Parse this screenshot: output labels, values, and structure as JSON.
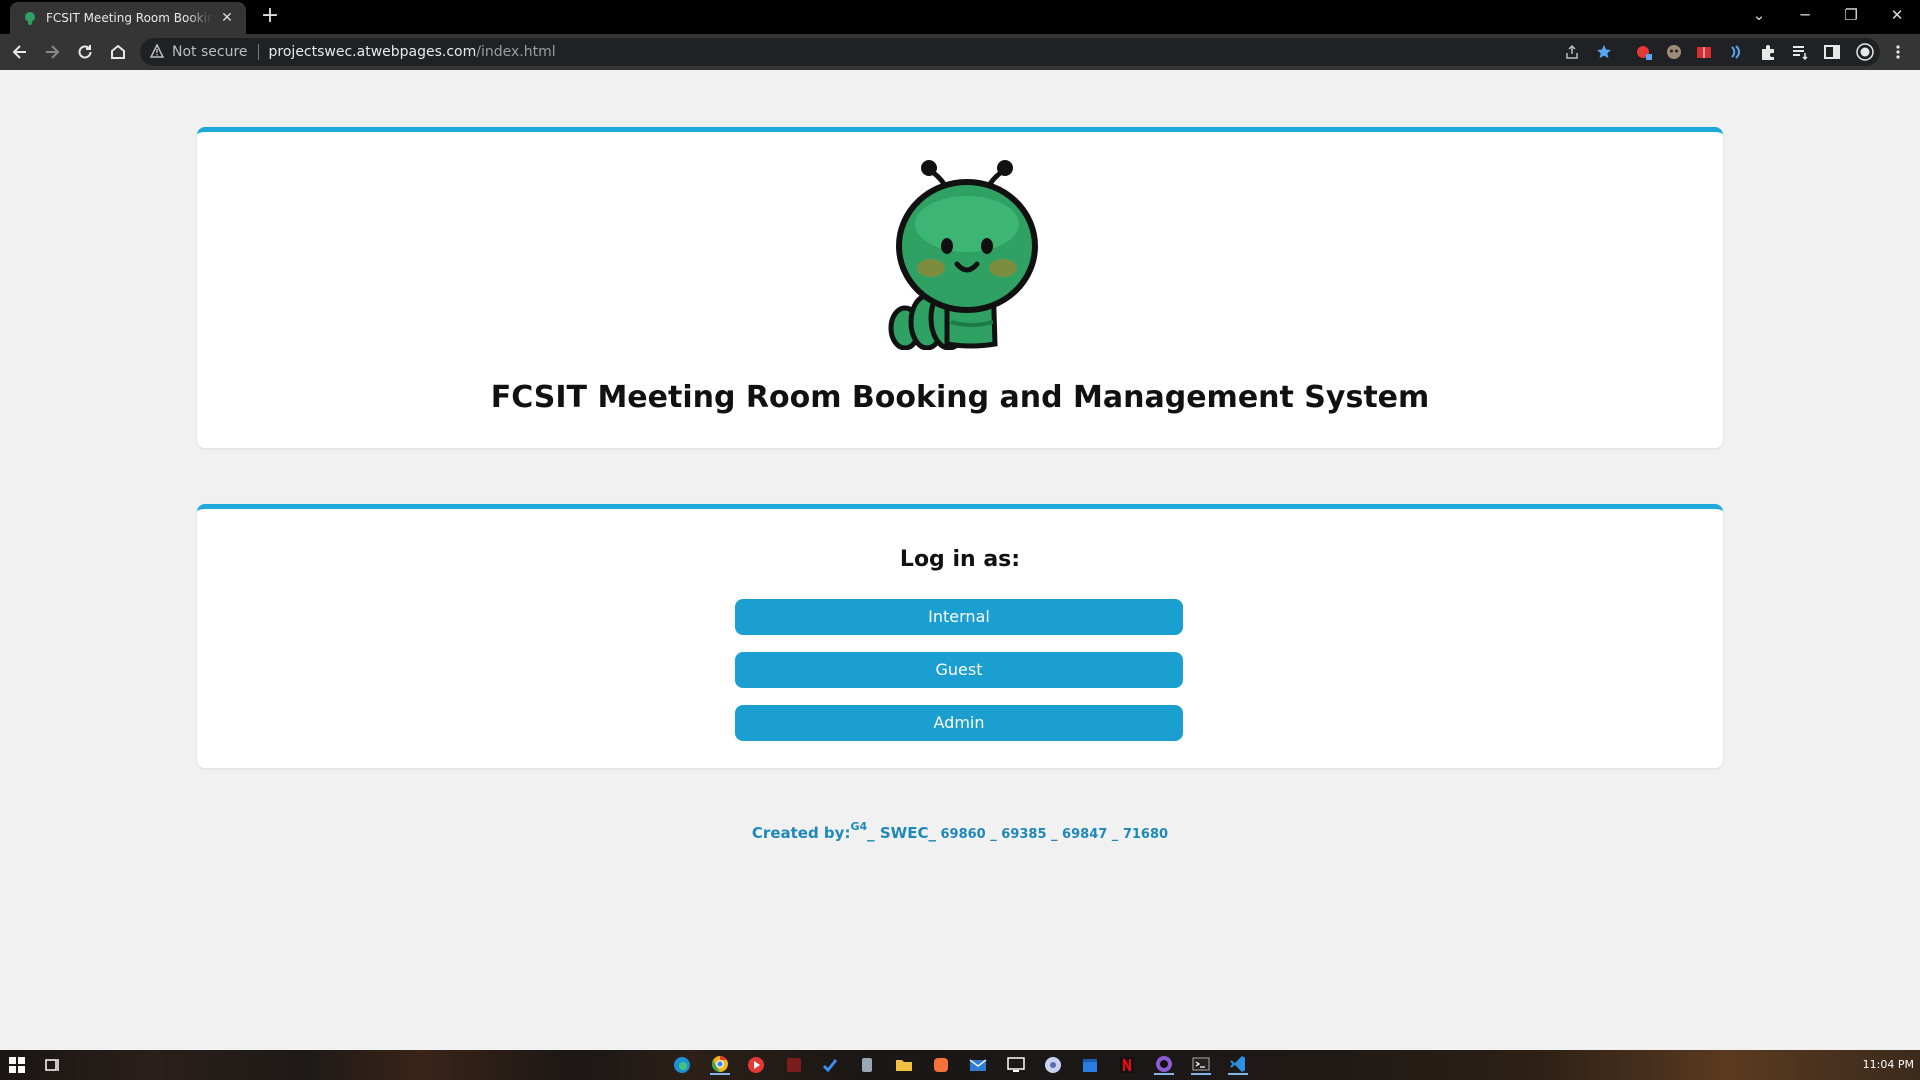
{
  "browser": {
    "tab_title": "FCSIT Meeting Room Booking and Management System",
    "security_label": "Not secure",
    "url_host": "projectswec.atwebpages.com",
    "url_path": "/index.html"
  },
  "page": {
    "title": "FCSIT Meeting Room Booking and Management System",
    "login_heading": "Log in as:",
    "buttons": {
      "internal": "Internal",
      "guest": "Guest",
      "admin": "Admin"
    },
    "footer": {
      "label": "Created by:",
      "superscript": "G4",
      "code": "_ SWEC_",
      "ids": " 69860 _ 69385 _ 69847 _ 71680"
    }
  },
  "colors": {
    "accent": "#1ea9dc",
    "button": "#1a9fd0",
    "footer_text": "#1e88b9",
    "mascot_green": "#2fa163"
  },
  "taskbar": {
    "clock": "11:04 PM"
  }
}
